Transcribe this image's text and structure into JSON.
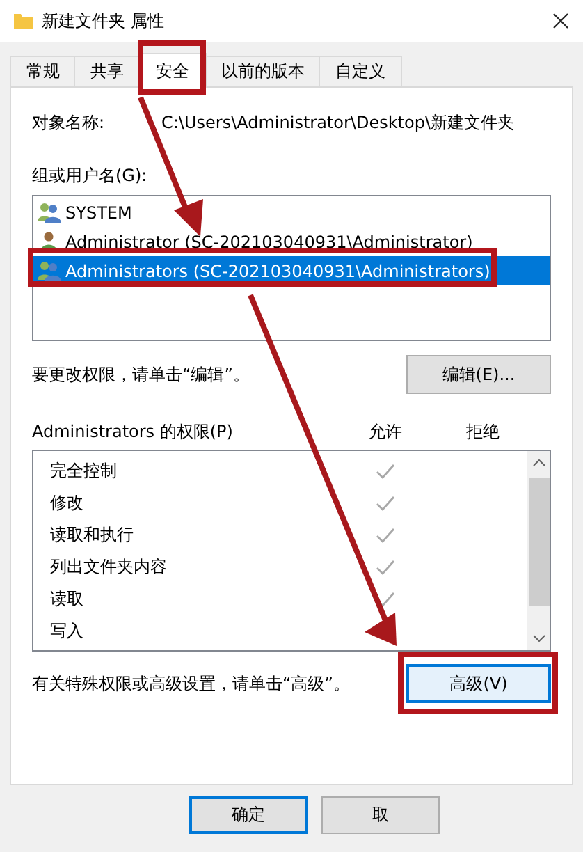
{
  "window": {
    "title": "新建文件夹 属性"
  },
  "tabs": [
    {
      "label": "常规",
      "selected": false,
      "annotated": false
    },
    {
      "label": "共享",
      "selected": false,
      "annotated": false
    },
    {
      "label": "安全",
      "selected": true,
      "annotated": true
    },
    {
      "label": "以前的版本",
      "selected": false,
      "annotated": false
    },
    {
      "label": "自定义",
      "selected": false,
      "annotated": false
    }
  ],
  "object_name": {
    "label": "对象名称:",
    "value": "C:\\Users\\Administrator\\Desktop\\新建文件夹"
  },
  "groups": {
    "label": "组或用户名(G):",
    "items": [
      {
        "name": "SYSTEM",
        "kind": "group",
        "selected": false,
        "annotated": false
      },
      {
        "name": "Administrator (SC-202103040931\\Administrator)",
        "kind": "user",
        "selected": false,
        "annotated": false
      },
      {
        "name": "Administrators (SC-202103040931\\Administrators)",
        "kind": "group",
        "selected": true,
        "annotated": true
      }
    ]
  },
  "edit_hint": "要更改权限，请单击“编辑”。",
  "edit_button": {
    "label": "编辑(E)..."
  },
  "permissions": {
    "label": "Administrators 的权限(P)",
    "allow_header": "允许",
    "deny_header": "拒绝",
    "items": [
      {
        "name": "完全控制",
        "allow": true,
        "deny": false
      },
      {
        "name": "修改",
        "allow": true,
        "deny": false
      },
      {
        "name": "读取和执行",
        "allow": true,
        "deny": false
      },
      {
        "name": "列出文件夹内容",
        "allow": true,
        "deny": false
      },
      {
        "name": "读取",
        "allow": true,
        "deny": false
      },
      {
        "name": "写入",
        "allow": false,
        "deny": false
      }
    ]
  },
  "advanced_hint": "有关特殊权限或高级设置，请单击“高级”。",
  "advanced_button": {
    "label": "高级(V)",
    "annotated": true
  },
  "buttons": [
    {
      "label": "确定",
      "focused": true
    },
    {
      "label": "取",
      "focused": false
    }
  ]
}
